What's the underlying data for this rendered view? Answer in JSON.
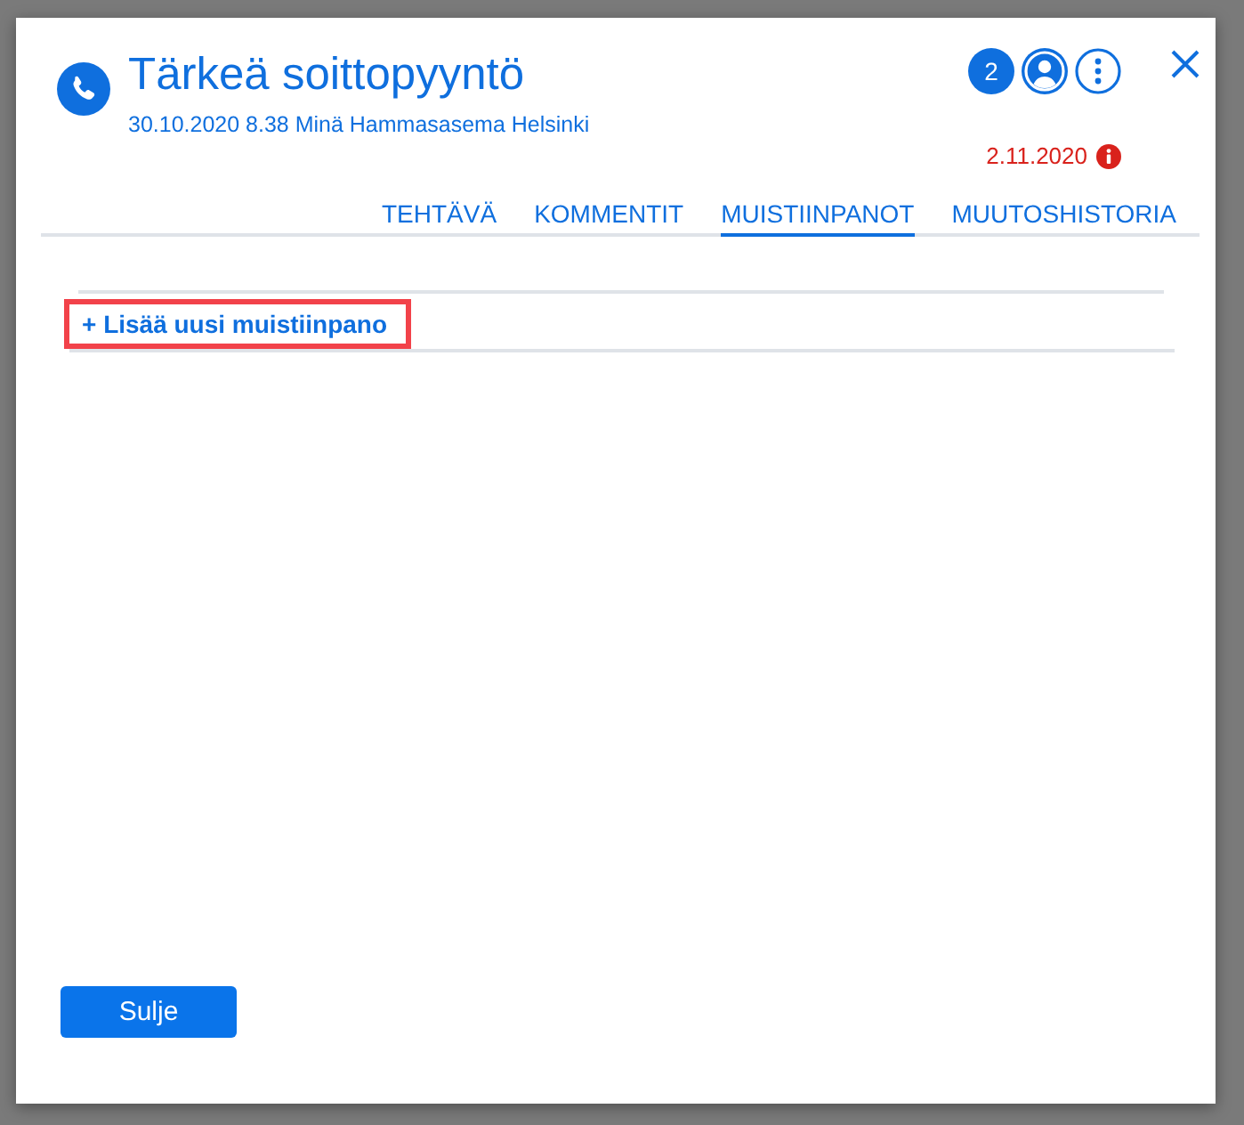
{
  "dialog": {
    "title": "Tärkeä soittopyyntö",
    "subtitle": "30.10.2020 8.38 Minä Hammasasema Helsinki",
    "badge": "2",
    "due": {
      "date": "2.11.2020",
      "overdue": true
    }
  },
  "tabs": [
    {
      "label": "TEHTÄVÄ",
      "selected": false
    },
    {
      "label": "KOMMENTIT",
      "selected": false
    },
    {
      "label": "MUISTIINPANOT",
      "selected": true
    },
    {
      "label": "MUUTOSHISTORIA",
      "selected": false
    }
  ],
  "add_note": {
    "label": "+ Lisää uusi muistiinpano",
    "highlighted": true
  },
  "footer": {
    "close_button": "Sulje"
  }
}
